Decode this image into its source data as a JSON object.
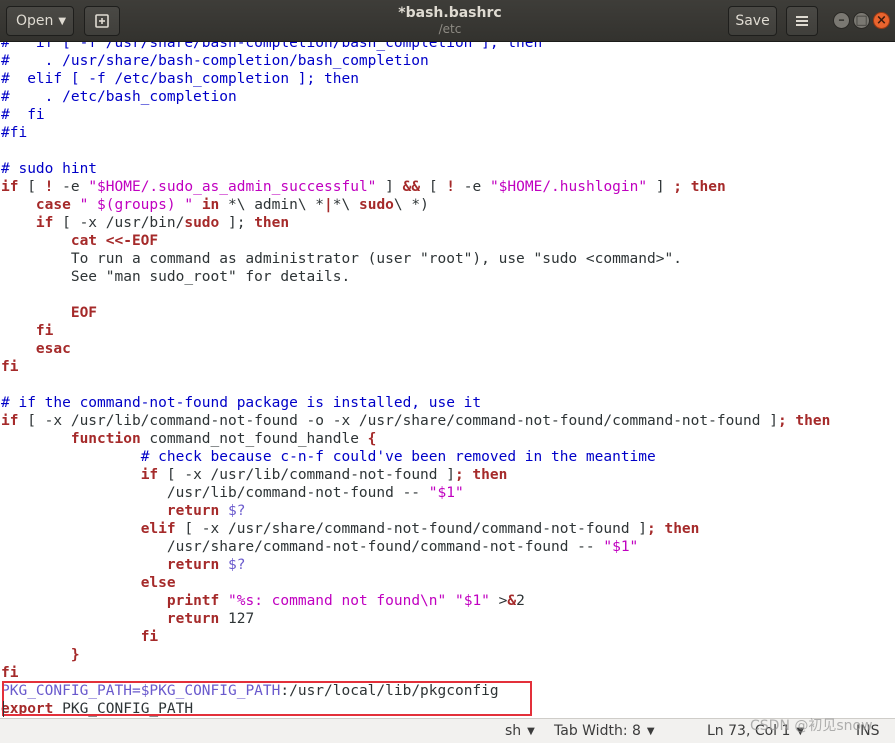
{
  "header": {
    "open_label": "Open",
    "title": "*bash.bashrc",
    "subtitle": "/etc",
    "save_label": "Save"
  },
  "editor": {
    "language": "sh",
    "lines": [
      [
        [
          "comment",
          "#   if [ -f /usr/share/bash-completion/bash_completion ]; then"
        ]
      ],
      [
        [
          "comment",
          "#    . /usr/share/bash-completion/bash_completion"
        ]
      ],
      [
        [
          "comment",
          "#  elif [ -f /etc/bash_completion ]; then"
        ]
      ],
      [
        [
          "comment",
          "#    . /etc/bash_completion"
        ]
      ],
      [
        [
          "comment",
          "#  fi"
        ]
      ],
      [
        [
          "comment",
          "#fi"
        ]
      ],
      [],
      [
        [
          "comment",
          "# sudo hint"
        ]
      ],
      [
        [
          "keyword",
          "if"
        ],
        [
          "plain",
          " [ "
        ],
        [
          "keyword",
          "!"
        ],
        [
          "plain",
          " -e "
        ],
        [
          "string",
          "\"$HOME/.sudo_as_admin_successful\""
        ],
        [
          "plain",
          " ] "
        ],
        [
          "keyword",
          "&&"
        ],
        [
          "plain",
          " [ "
        ],
        [
          "keyword",
          "!"
        ],
        [
          "plain",
          " -e "
        ],
        [
          "string",
          "\"$HOME/.hushlogin\""
        ],
        [
          "plain",
          " ] "
        ],
        [
          "keyword",
          "; then"
        ]
      ],
      [
        [
          "plain",
          "    "
        ],
        [
          "keyword",
          "case"
        ],
        [
          "plain",
          " "
        ],
        [
          "string",
          "\" $(groups) \""
        ],
        [
          "plain",
          " "
        ],
        [
          "keyword",
          "in"
        ],
        [
          "plain",
          " *\\ admin\\ *"
        ],
        [
          "keyword",
          "|"
        ],
        [
          "plain",
          "*\\ "
        ],
        [
          "keyword",
          "sudo"
        ],
        [
          "plain",
          "\\ *)"
        ]
      ],
      [
        [
          "plain",
          "    "
        ],
        [
          "keyword",
          "if"
        ],
        [
          "plain",
          " [ -x /usr/bin/"
        ],
        [
          "keyword",
          "sudo"
        ],
        [
          "plain",
          " ]; "
        ],
        [
          "keyword",
          "then"
        ]
      ],
      [
        [
          "plain",
          "        "
        ],
        [
          "keyword",
          "cat <<-EOF"
        ]
      ],
      [
        [
          "plain",
          "        To run a command as administrator (user \"root\"), use \"sudo <command>\"."
        ]
      ],
      [
        [
          "plain",
          "        See \"man sudo_root\" for details."
        ]
      ],
      [],
      [
        [
          "plain",
          "        "
        ],
        [
          "keyword",
          "EOF"
        ]
      ],
      [
        [
          "plain",
          "    "
        ],
        [
          "keyword",
          "fi"
        ]
      ],
      [
        [
          "plain",
          "    "
        ],
        [
          "keyword",
          "esac"
        ]
      ],
      [
        [
          "keyword",
          "fi"
        ]
      ],
      [],
      [
        [
          "comment",
          "# if the command-not-found package is installed, use it"
        ]
      ],
      [
        [
          "keyword",
          "if"
        ],
        [
          "plain",
          " [ -x /usr/lib/command-not-found -o -x /usr/share/command-not-found/command-not-found ]"
        ],
        [
          "keyword",
          "; then"
        ]
      ],
      [
        [
          "plain",
          "        "
        ],
        [
          "keyword",
          "function"
        ],
        [
          "plain",
          " command_not_found_handle "
        ],
        [
          "keyword",
          "{"
        ]
      ],
      [
        [
          "plain",
          "                "
        ],
        [
          "comment",
          "# check because c-n-f could've been removed in the meantime"
        ]
      ],
      [
        [
          "plain",
          "                "
        ],
        [
          "keyword",
          "if"
        ],
        [
          "plain",
          " [ -x /usr/lib/command-not-found ]"
        ],
        [
          "keyword",
          "; then"
        ]
      ],
      [
        [
          "plain",
          "                   /usr/lib/command-not-found -- "
        ],
        [
          "string",
          "\"$1\""
        ]
      ],
      [
        [
          "plain",
          "                   "
        ],
        [
          "keyword",
          "return"
        ],
        [
          "plain",
          " "
        ],
        [
          "variable",
          "$?"
        ]
      ],
      [
        [
          "plain",
          "                "
        ],
        [
          "keyword",
          "elif"
        ],
        [
          "plain",
          " [ -x /usr/share/command-not-found/command-not-found ]"
        ],
        [
          "keyword",
          "; then"
        ]
      ],
      [
        [
          "plain",
          "                   /usr/share/command-not-found/command-not-found -- "
        ],
        [
          "string",
          "\"$1\""
        ]
      ],
      [
        [
          "plain",
          "                   "
        ],
        [
          "keyword",
          "return"
        ],
        [
          "plain",
          " "
        ],
        [
          "variable",
          "$?"
        ]
      ],
      [
        [
          "plain",
          "                "
        ],
        [
          "keyword",
          "else"
        ]
      ],
      [
        [
          "plain",
          "                   "
        ],
        [
          "keyword",
          "printf"
        ],
        [
          "plain",
          " "
        ],
        [
          "string",
          "\"%s: command not found\\n\""
        ],
        [
          "plain",
          " "
        ],
        [
          "string",
          "\"$1\""
        ],
        [
          "plain",
          " >"
        ],
        [
          "keyword",
          "&"
        ],
        [
          "plain",
          "2"
        ]
      ],
      [
        [
          "plain",
          "                   "
        ],
        [
          "keyword",
          "return"
        ],
        [
          "plain",
          " 127"
        ]
      ],
      [
        [
          "plain",
          "                "
        ],
        [
          "keyword",
          "fi"
        ]
      ],
      [
        [
          "plain",
          "        "
        ],
        [
          "keyword",
          "}"
        ]
      ],
      [
        [
          "keyword",
          "fi"
        ]
      ],
      [
        [
          "variable",
          "PKG_CONFIG_PATH="
        ],
        [
          "variable",
          "$PKG_CONFIG_PATH"
        ],
        [
          "plain",
          ":/usr/local/lib/pkgconfig"
        ]
      ],
      [
        [
          "keyword",
          "export"
        ],
        [
          "plain",
          " PKG_CONFIG_PATH"
        ]
      ]
    ]
  },
  "statusbar": {
    "language": "sh",
    "tab_width": "Tab Width: 8",
    "position": "Ln 73, Col 1",
    "mode": "INS"
  },
  "watermark": "CSDN @初见snow"
}
